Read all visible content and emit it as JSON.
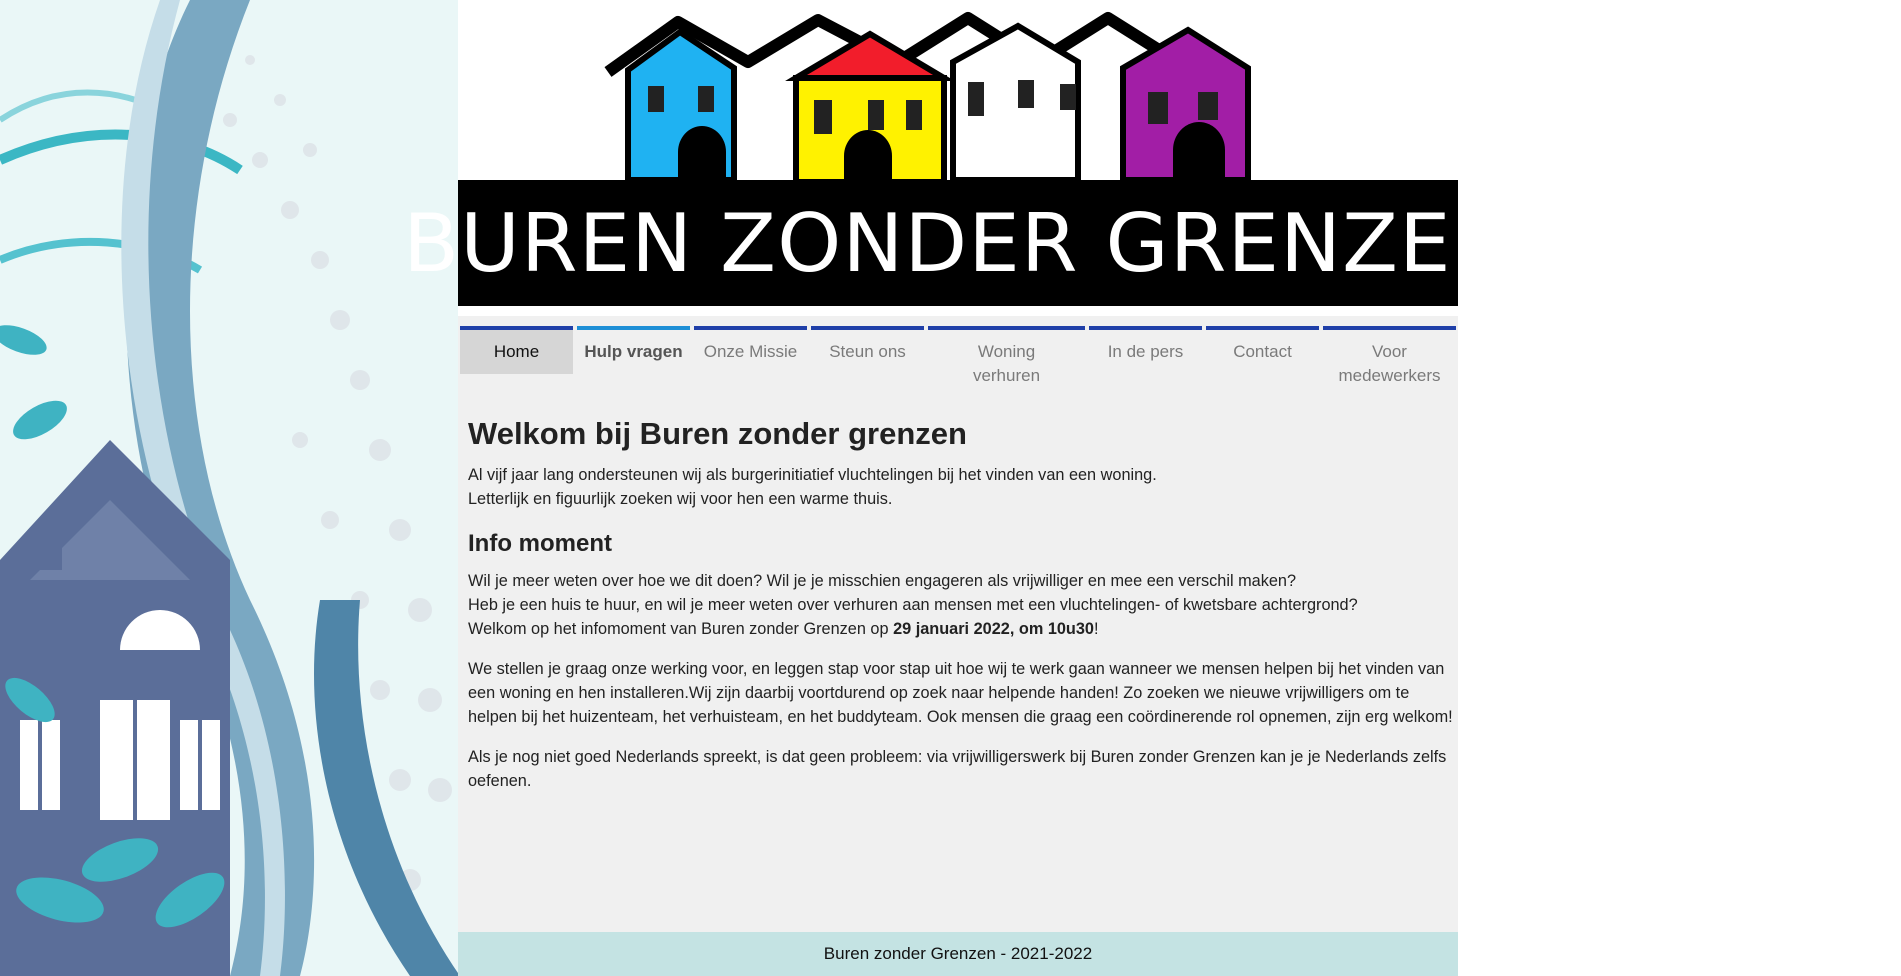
{
  "banner": {
    "title": "BUREN ZONDER GRENZEN",
    "house_colors": [
      "#1fb2f2",
      "#fff200",
      "#ffffff",
      "#a21ea6"
    ],
    "roof_accent": "#f21d2b"
  },
  "nav": {
    "items": [
      {
        "label": "Home"
      },
      {
        "label": "Hulp vragen"
      },
      {
        "label": "Onze Missie"
      },
      {
        "label": "Steun ons"
      },
      {
        "label": "Woning verhuren"
      },
      {
        "label": "In de pers"
      },
      {
        "label": "Contact"
      },
      {
        "label": "Voor medewerkers"
      }
    ],
    "accent": "#1f3fa8",
    "active_accent": "#1e8fd6"
  },
  "main": {
    "title": "Welkom bij Buren zonder grenzen",
    "intro_line1": "Al vijf jaar lang ondersteunen wij als burgerinitiatief vluchtelingen bij het vinden van een woning.",
    "intro_line2": "Letterlijk en figuurlijk zoeken wij voor hen een warme thuis.",
    "info_heading": "Info moment",
    "info_line1": "Wil je meer weten over hoe we dit doen? Wil je je misschien engageren als vrijwilliger en mee een verschil maken?",
    "info_line2": "Heb je een huis te huur, en wil je meer weten over verhuren aan mensen met een vluchtelingen- of kwetsbare achtergrond?",
    "info_line3_prefix": "Welkom op het infomoment van Buren zonder Grenzen op ",
    "info_line3_date": "29 januari 2022, om 10u30",
    "info_line3_suffix": "!",
    "para2": "We stellen je graag onze werking voor, en leggen stap voor stap uit hoe wij te werk gaan wanneer we mensen helpen bij het vinden van een woning en hen installeren.Wij zijn daarbij voortdurend op zoek naar helpende handen! Zo zoeken we nieuwe vrijwilligers om te helpen bij het huizenteam, het verhuisteam, en het buddyteam. Ook mensen die graag een coördinerende rol opnemen, zijn erg welkom!",
    "para3": "Als je nog niet goed Nederlands spreekt, is dat geen probleem: via vrijwilligerswerk bij Buren zonder Grenzen kan je je Nederlands zelfs oefenen."
  },
  "footer": {
    "text": "Buren zonder Grenzen - 2021-2022",
    "background": "#c4e3e3"
  }
}
